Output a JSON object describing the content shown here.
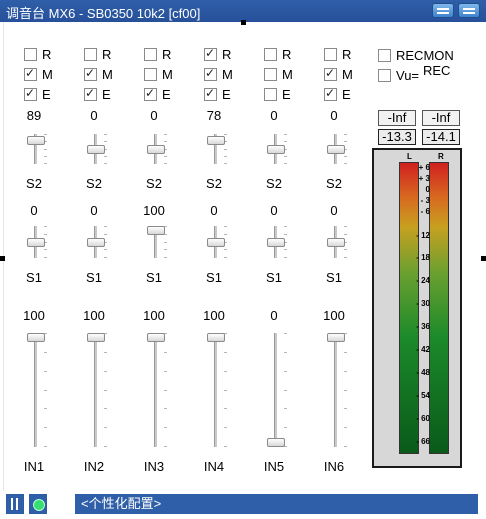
{
  "window": {
    "title": "调音台 MX6 - SB0350 10k2 [cf00]"
  },
  "channels": [
    {
      "label": "IN1",
      "r": false,
      "m": true,
      "e": true,
      "s2": "89",
      "s1": "0",
      "level": "100",
      "s2_pos": 0.1,
      "s1_pos": 0.5,
      "fader_pos": 0.0
    },
    {
      "label": "IN2",
      "r": false,
      "m": true,
      "e": true,
      "s2": "0",
      "s1": "0",
      "level": "100",
      "s2_pos": 0.5,
      "s1_pos": 0.5,
      "fader_pos": 0.0
    },
    {
      "label": "IN3",
      "r": false,
      "m": false,
      "e": true,
      "s2": "0",
      "s1": "100",
      "level": "100",
      "s2_pos": 0.5,
      "s1_pos": 0.0,
      "fader_pos": 0.0
    },
    {
      "label": "IN4",
      "r": true,
      "m": true,
      "e": true,
      "s2": "78",
      "s1": "0",
      "level": "100",
      "s2_pos": 0.1,
      "s1_pos": 0.5,
      "fader_pos": 0.0
    },
    {
      "label": "IN5",
      "r": false,
      "m": false,
      "e": false,
      "s2": "0",
      "s1": "0",
      "level": "0",
      "s2_pos": 0.5,
      "s1_pos": 0.5,
      "fader_pos": 1.0
    },
    {
      "label": "IN6",
      "r": false,
      "m": true,
      "e": true,
      "s2": "0",
      "s1": "0",
      "level": "100",
      "s2_pos": 0.5,
      "s1_pos": 0.5,
      "fader_pos": 0.0
    }
  ],
  "send_labels": {
    "r": "R",
    "m": "M",
    "e": "E",
    "s2": "S2",
    "s1": "S1"
  },
  "options": {
    "recmon": "RECMON",
    "vu": "Vu=",
    "vu_sup": "REC",
    "recmon_on": false,
    "vu_on": false
  },
  "meter": {
    "peak_left": "-Inf",
    "peak_right": "-Inf",
    "rms_left": "-13.3",
    "rms_right": "-14.1",
    "left_label": "L",
    "right_label": "R",
    "scale": [
      "+ 6",
      "+ 3",
      "0",
      "- 3",
      "- 6",
      "- 12",
      "- 18",
      "- 24",
      "- 30",
      "- 36",
      "- 42",
      "- 48",
      "- 54",
      "- 60",
      "- 66"
    ]
  },
  "bottom": {
    "preset": "<个性化配置>"
  },
  "colors": {
    "title_bar": "#2f5fa8",
    "preset_bar": "#2f5fa8"
  }
}
